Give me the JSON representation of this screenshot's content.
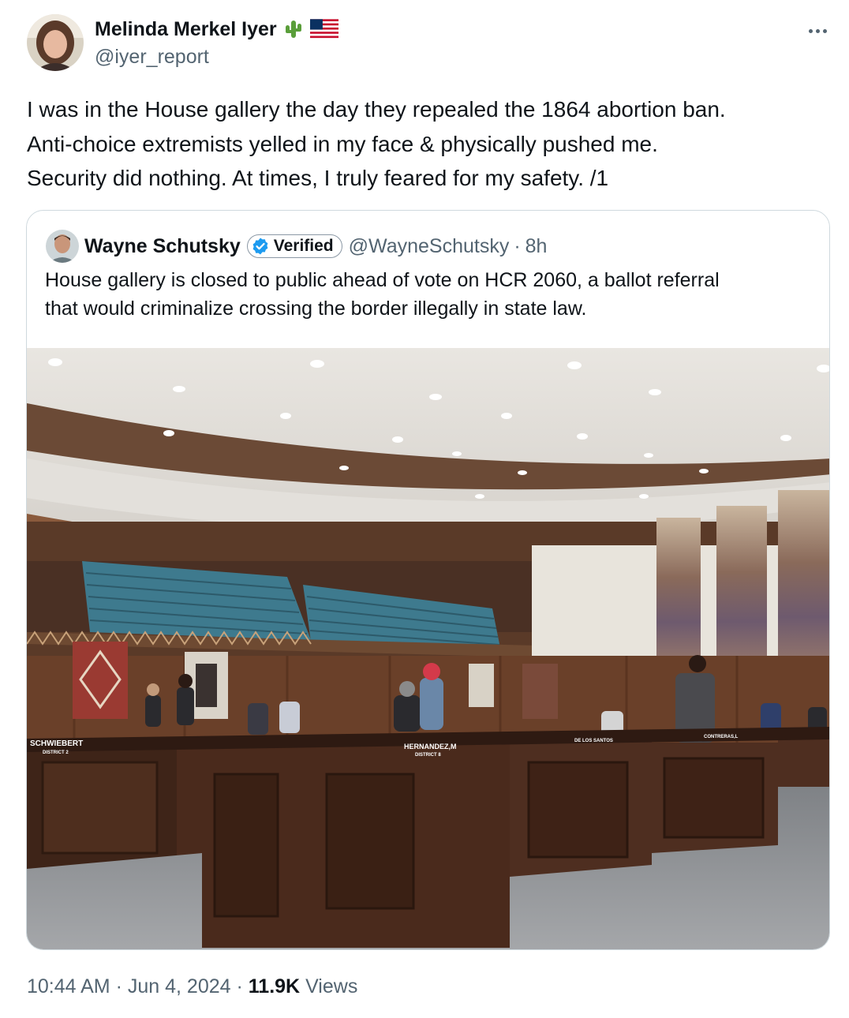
{
  "author": {
    "name": "Melinda Merkel Iyer",
    "handle": "@iyer_report",
    "name_emoji": [
      "cactus-icon",
      "us-flag-icon"
    ]
  },
  "tweet": {
    "text": "I was in the House gallery the day they repealed the 1864 abortion ban.\nAnti-choice extremists yelled in my face & physically pushed me.\nSecurity did nothing. At times, I truly feared for my safety.  /1"
  },
  "quoted_tweet": {
    "name": "Wayne Schutsky",
    "verified_label": "Verified",
    "handle": "@WayneSchutsky",
    "separator": "·",
    "age": "8h",
    "text": "House gallery is closed to public ahead of vote on HCR 2060, a ballot referral\nthat would criminalize crossing the border illegally in state law.",
    "photo": {
      "desk_labels": [
        "SCHWIEBERT",
        "DISTRICT 2",
        "HERNANDEZ,M",
        "DISTRICT 8",
        "DE LOS SANTOS",
        "CONTRERAS,L"
      ]
    }
  },
  "meta": {
    "time": "10:44 AM",
    "sep1": "·",
    "date": "Jun 4, 2024",
    "sep2": "·",
    "views_count": "11.9K",
    "views_label": "Views"
  },
  "colors": {
    "text": "#0f1419",
    "secondary": "#536471",
    "border": "#cfd9de",
    "verified": "#1d9bf0"
  }
}
